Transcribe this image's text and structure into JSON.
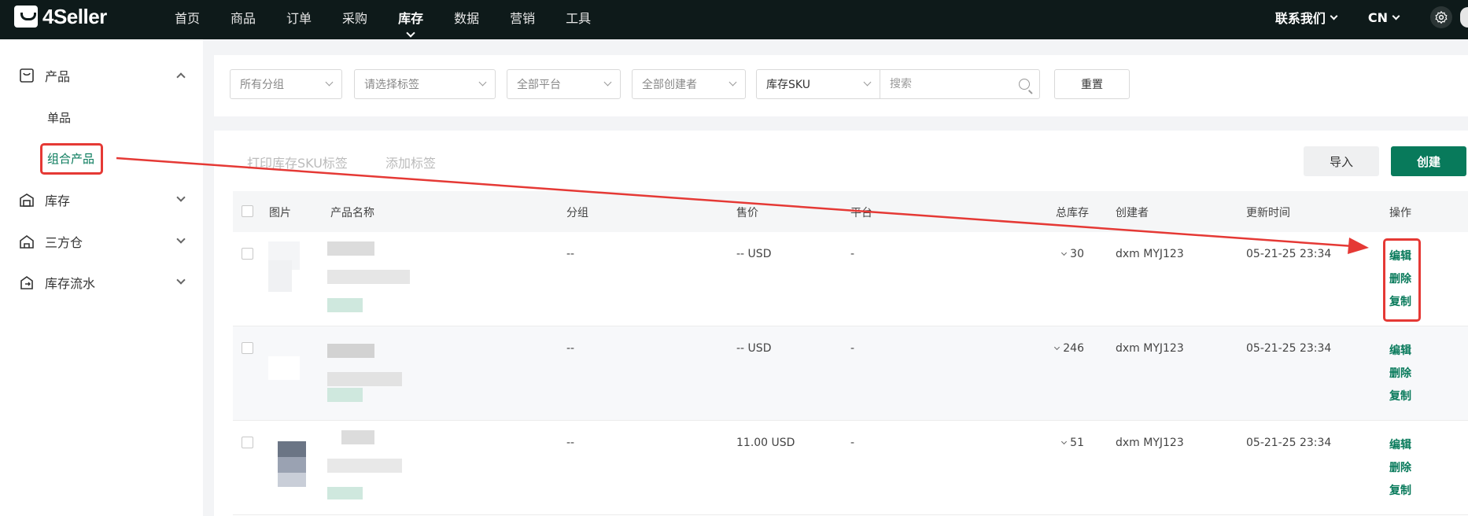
{
  "brand": {
    "name": "4Seller"
  },
  "nav": {
    "items": [
      "首页",
      "商品",
      "订单",
      "采购",
      "库存",
      "数据",
      "营销",
      "工具"
    ],
    "active": "库存"
  },
  "top_right": {
    "contact": "联系我们",
    "lang": "CN"
  },
  "sidebar": {
    "groups": [
      {
        "label": "产品",
        "icon": "product-icon",
        "expanded": true
      },
      {
        "label": "库存",
        "icon": "inventory-icon",
        "expanded": false
      },
      {
        "label": "三方仓",
        "icon": "warehouse-icon",
        "expanded": false
      },
      {
        "label": "库存流水",
        "icon": "inventory-flow-icon",
        "expanded": false
      }
    ],
    "sub_items": [
      "单品",
      "组合产品"
    ],
    "active_sub": "组合产品"
  },
  "filters": {
    "group": "所有分组",
    "tag": "请选择标签",
    "platform": "全部平台",
    "creator": "全部创建者",
    "sku_type": "库存SKU",
    "search_placeholder": "搜索",
    "reset": "重置"
  },
  "toolbar": {
    "print_label": "打印库存SKU标签",
    "add_tag": "添加标签",
    "import": "导入",
    "create": "创建"
  },
  "table": {
    "headers": [
      "图片",
      "产品名称",
      "分组",
      "售价",
      "平台",
      "总库存",
      "创建者",
      "更新时间",
      "操作"
    ],
    "rows": [
      {
        "group": "--",
        "price": "-- USD",
        "platform": "-",
        "stock": "30",
        "creator": "dxm MYJ123",
        "updated": "05-21-25 23:34"
      },
      {
        "group": "--",
        "price": "-- USD",
        "platform": "-",
        "stock": "246",
        "creator": "dxm MYJ123",
        "updated": "05-21-25 23:34"
      },
      {
        "group": "--",
        "price": "11.00 USD",
        "platform": "-",
        "stock": "51",
        "creator": "dxm MYJ123",
        "updated": "05-21-25 23:34"
      }
    ],
    "actions": [
      "编辑",
      "删除",
      "复制"
    ]
  },
  "colors": {
    "brand_green": "#087a5b",
    "topbar": "#0e1a1a",
    "annotation": "#e53935"
  }
}
